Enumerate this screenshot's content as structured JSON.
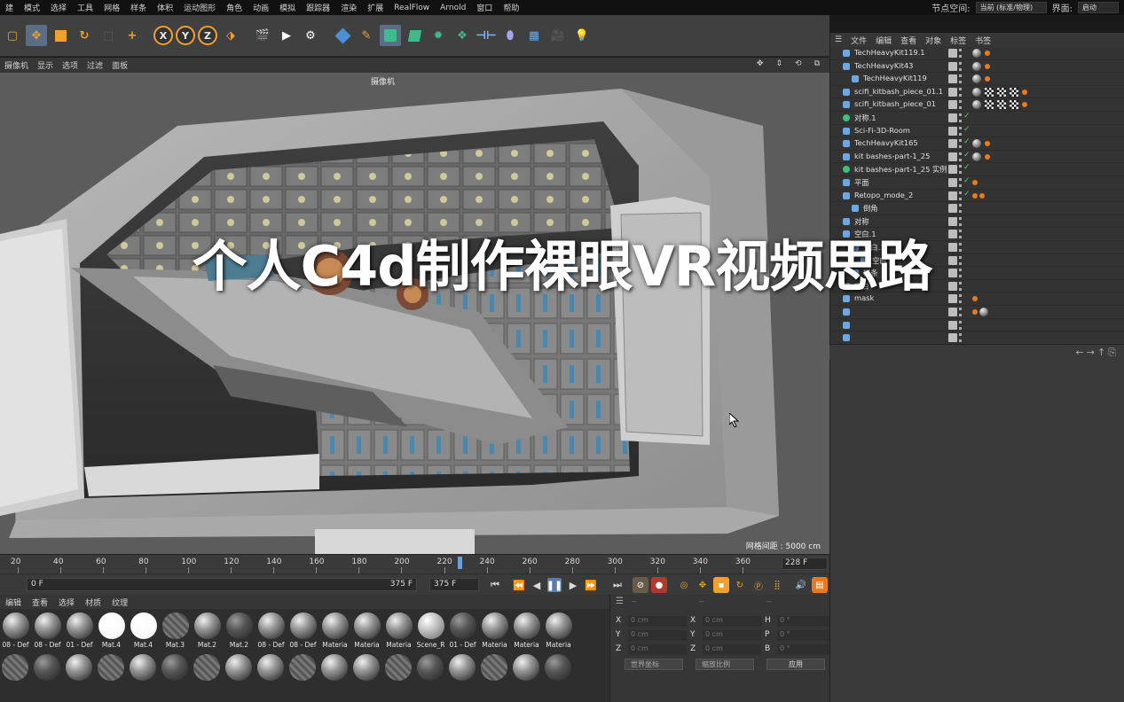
{
  "menu": [
    "建",
    "模式",
    "选择",
    "工具",
    "网格",
    "样条",
    "体积",
    "运动图形",
    "角色",
    "动画",
    "模拟",
    "跟踪器",
    "渲染",
    "扩展",
    "RealFlow",
    "Arnold",
    "窗口",
    "帮助"
  ],
  "node_space": {
    "label": "节点空间:",
    "value": "当前 (标准/物理)"
  },
  "layout": {
    "label": "界面:",
    "value": "启动"
  },
  "toolbar": {
    "axes": [
      "X",
      "Y",
      "Z"
    ]
  },
  "viewport": {
    "menu": [
      "摄像机",
      "显示",
      "选项",
      "过滤",
      "面板"
    ],
    "camera_label": "摄像机",
    "grid_spacing": "网格间距 : 5000 cm",
    "overlay_title": "个人C4d制作裸眼VR视频思路"
  },
  "timeline": {
    "ticks": [
      "20",
      "40",
      "60",
      "80",
      "100",
      "120",
      "140",
      "160",
      "180",
      "200",
      "220",
      "240",
      "260",
      "280",
      "300",
      "320",
      "340",
      "360"
    ],
    "current_frame": "228 F",
    "playhead_fraction": 0.633
  },
  "transport": {
    "start": "0 F",
    "end_a": "375 F",
    "end_b": "375 F"
  },
  "material_manager": {
    "menu": [
      "编辑",
      "查看",
      "选择",
      "材质",
      "纹理"
    ],
    "materials": [
      {
        "label": "08 - Def",
        "kind": "grey"
      },
      {
        "label": "08 - Def",
        "kind": "grey"
      },
      {
        "label": "01 - Def",
        "kind": "grey"
      },
      {
        "label": "Mat.4",
        "kind": "white"
      },
      {
        "label": "Mat.4",
        "kind": "white"
      },
      {
        "label": "Mat.3",
        "kind": "tex"
      },
      {
        "label": "Mat.2",
        "kind": "grey"
      },
      {
        "label": "Mat.2",
        "kind": "dark"
      },
      {
        "label": "08 - Def",
        "kind": "grey"
      },
      {
        "label": "08 - Def",
        "kind": "grey"
      },
      {
        "label": "Materia",
        "kind": "grey"
      },
      {
        "label": "Materia",
        "kind": "grey"
      },
      {
        "label": "Materia",
        "kind": "grey"
      },
      {
        "label": "Scene_R",
        "kind": "scene"
      },
      {
        "label": "01 - Def",
        "kind": "dark"
      },
      {
        "label": "Materia",
        "kind": "grey"
      },
      {
        "label": "Materia",
        "kind": "grey"
      },
      {
        "label": "Materia",
        "kind": "grey"
      }
    ]
  },
  "coordinates": {
    "header": [
      "--",
      "--",
      "--"
    ],
    "rows": [
      {
        "a": "X",
        "av": "0 cm",
        "b": "X",
        "bv": "0 cm",
        "c": "H",
        "cv": "0 °"
      },
      {
        "a": "Y",
        "av": "0 cm",
        "b": "Y",
        "bv": "0 cm",
        "c": "P",
        "cv": "0 °"
      },
      {
        "a": "Z",
        "av": "0 cm",
        "b": "Z",
        "bv": "0 cm",
        "c": "B",
        "cv": "0 °"
      }
    ],
    "world": "世界坐标",
    "scale": "缩放比例",
    "apply": "应用"
  },
  "object_manager": {
    "menu": [
      "文件",
      "编辑",
      "查看",
      "对象",
      "标签",
      "书签"
    ],
    "objects": [
      {
        "name": "TechHeavyKit119.1",
        "indent": 0,
        "icon": "blue",
        "tags": [
          "sphere",
          "orange"
        ]
      },
      {
        "name": "TechHeavyKit43",
        "indent": 0,
        "icon": "blue",
        "tags": [
          "sphere",
          "orange"
        ]
      },
      {
        "name": "TechHeavyKit119",
        "indent": 1,
        "icon": "blue",
        "tags": [
          "sphere",
          "orange"
        ]
      },
      {
        "name": "scifi_kitbash_piece_01.1",
        "indent": 0,
        "icon": "blue",
        "tags": [
          "sphere",
          "check",
          "check",
          "check",
          "orange"
        ]
      },
      {
        "name": "scifi_kitbash_piece_01",
        "indent": 0,
        "icon": "blue",
        "tags": [
          "sphere",
          "check",
          "check",
          "check",
          "orange"
        ]
      },
      {
        "name": "对称.1",
        "indent": 0,
        "icon": "green",
        "tags": []
      },
      {
        "name": "Sci-Fi-3D-Room",
        "indent": 0,
        "icon": "blue",
        "tags": []
      },
      {
        "name": "TechHeavyKit165",
        "indent": 0,
        "icon": "blue",
        "tags": [
          "sphere",
          "orange"
        ]
      },
      {
        "name": "kit bashes-part-1_25",
        "indent": 0,
        "icon": "blue",
        "tags": [
          "sphere",
          "orange"
        ]
      },
      {
        "name": "kit bashes-part-1_25 实例",
        "indent": 0,
        "icon": "green",
        "tags": []
      },
      {
        "name": "平面",
        "indent": 0,
        "icon": "blue",
        "tags": [
          "orange"
        ]
      },
      {
        "name": "Retopo_mode_2",
        "indent": 0,
        "icon": "blue",
        "tags": [
          "orange",
          "orange"
        ]
      },
      {
        "name": "倒角",
        "indent": 1,
        "icon": "blue",
        "tags": []
      },
      {
        "name": "对称",
        "indent": 0,
        "icon": "blue",
        "tags": []
      },
      {
        "name": "空白.1",
        "indent": 0,
        "icon": "blue",
        "tags": []
      },
      {
        "name": "空白.1",
        "indent": 1,
        "icon": "blue",
        "tags": []
      },
      {
        "name": "空白",
        "indent": 2,
        "icon": "blue",
        "tags": []
      },
      {
        "name": "样条",
        "indent": 1,
        "icon": "blue",
        "tags": []
      },
      {
        "name": "空白",
        "indent": 0,
        "icon": "blue",
        "tags": []
      },
      {
        "name": "mask",
        "indent": 0,
        "icon": "blue",
        "tags": [
          "orange"
        ]
      },
      {
        "name": "",
        "indent": 0,
        "icon": "blue",
        "tags": [
          "orange",
          "dark"
        ]
      },
      {
        "name": "",
        "indent": 0,
        "icon": "blue",
        "tags": []
      },
      {
        "name": "",
        "indent": 0,
        "icon": "blue",
        "tags": []
      }
    ]
  }
}
